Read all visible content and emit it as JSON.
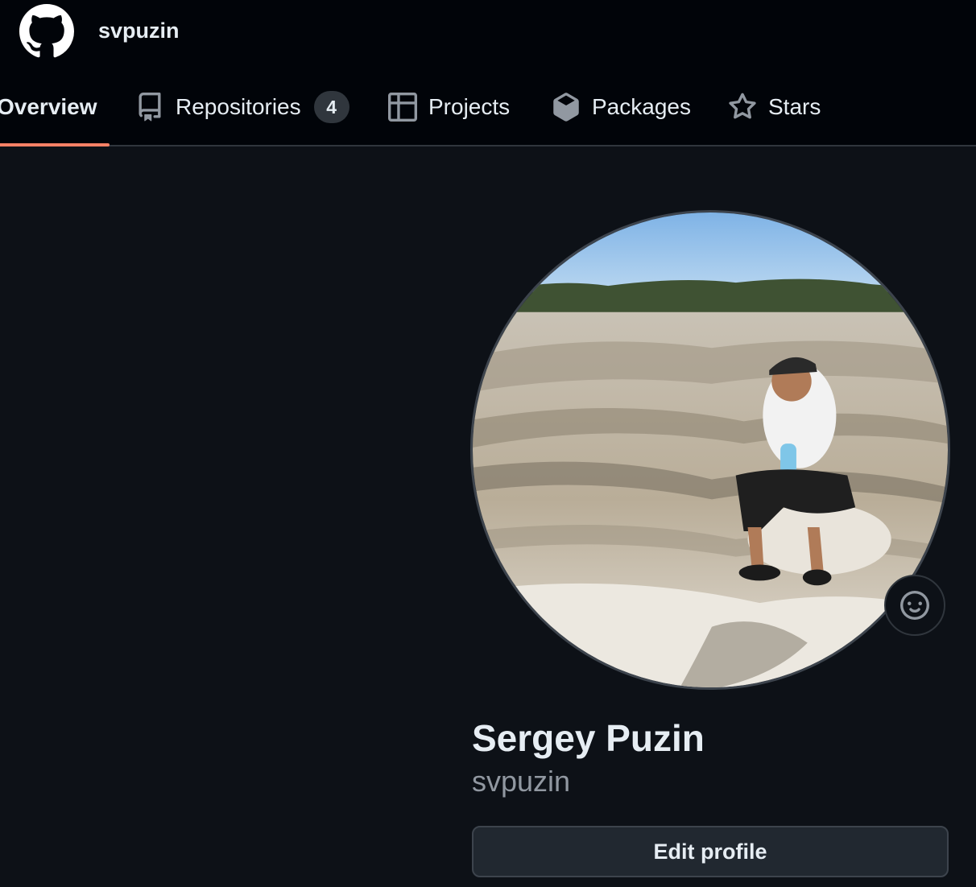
{
  "header": {
    "logo_icon": "github-mark-icon",
    "username": "svpuzin"
  },
  "tabs": [
    {
      "label": "Overview",
      "icon": "book-icon",
      "selected": true
    },
    {
      "label": "Repositories",
      "icon": "repo-icon",
      "count": "4"
    },
    {
      "label": "Projects",
      "icon": "table-icon"
    },
    {
      "label": "Packages",
      "icon": "package-icon"
    },
    {
      "label": "Stars",
      "icon": "star-icon"
    }
  ],
  "profile": {
    "full_name": "Sergey Puzin",
    "login": "svpuzin",
    "edit_button_label": "Edit profile",
    "status_icon": "smiley-icon"
  },
  "colors": {
    "background": "#0d1117",
    "header_background": "#010409",
    "selected_tab_underline": "#f78166",
    "muted_text": "#9198a1"
  }
}
